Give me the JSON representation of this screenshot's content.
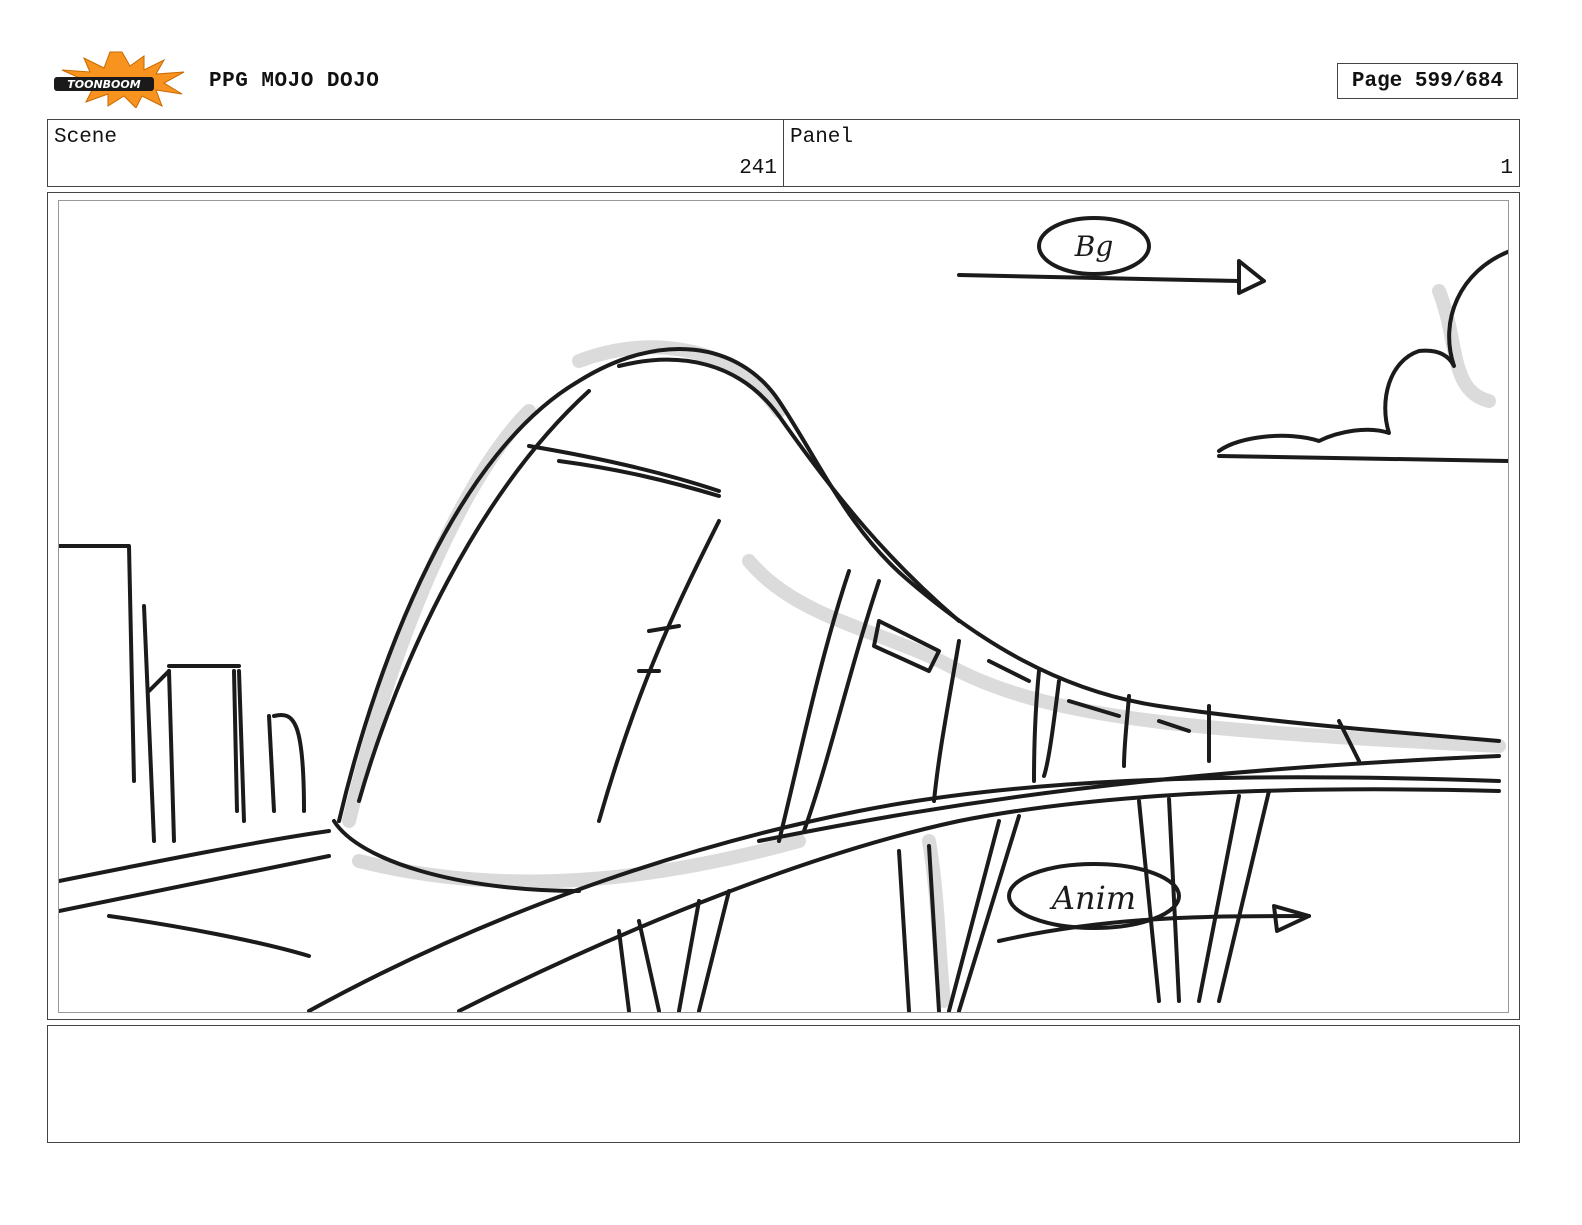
{
  "header": {
    "logo_text": "TOONBOOM",
    "project_title": "PPG MOJO DOJO",
    "page_label": "Page 599/684"
  },
  "scene": {
    "label": "Scene",
    "value": "241"
  },
  "panel": {
    "label": "Panel",
    "value": "1"
  },
  "sketch": {
    "annotation_bg": "Bg",
    "annotation_anim": "Anim"
  },
  "notes": {
    "text": ""
  },
  "colors": {
    "logo_burst": "#f7931e",
    "logo_band": "#1a1a1a",
    "frame_border": "#999999"
  }
}
